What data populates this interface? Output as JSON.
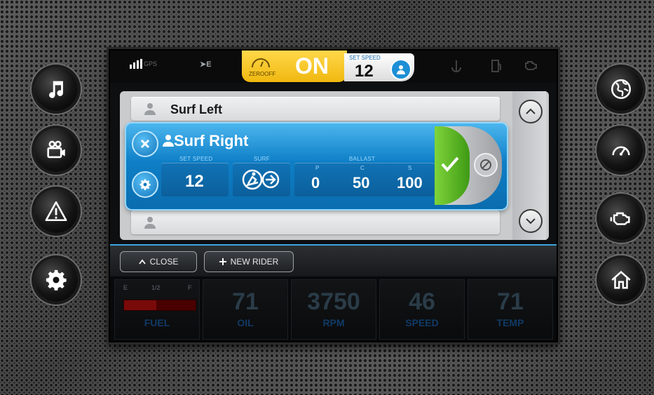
{
  "left_buttons": [
    {
      "icon": "music-note-icon"
    },
    {
      "icon": "video-camera-icon"
    },
    {
      "icon": "warning-icon"
    },
    {
      "icon": "gear-icon"
    }
  ],
  "right_buttons": [
    {
      "icon": "globe-icon"
    },
    {
      "icon": "speedometer-icon"
    },
    {
      "icon": "engine-icon"
    },
    {
      "icon": "home-icon"
    }
  ],
  "topbar": {
    "gps_label": "GPS",
    "heading": "➤E",
    "zero_off_label": "ZEROOFF",
    "zero_off_state": "ON",
    "set_speed_label": "SET SPEED",
    "set_speed_value": "12"
  },
  "riders": {
    "above": "Surf Left",
    "below": "",
    "selected": {
      "name": "Surf Right",
      "set_speed_label": "SET SPEED",
      "set_speed_value": "12",
      "surf_label": "SURF",
      "ballast_label": "BALLAST",
      "ballast": [
        {
          "label": "P",
          "value": "0"
        },
        {
          "label": "C",
          "value": "50"
        },
        {
          "label": "S",
          "value": "100"
        }
      ]
    }
  },
  "bottombar": {
    "close_label": "CLOSE",
    "new_rider_label": "NEW RIDER"
  },
  "gauges": {
    "fuel": {
      "label": "FUEL",
      "e": "E",
      "half": "1/2",
      "f": "F",
      "level": 0.45
    },
    "oil": {
      "value": "71",
      "label": "OIL"
    },
    "rpm": {
      "value": "3750",
      "label": "RPM"
    },
    "speed": {
      "value": "46",
      "label": "SPEED"
    },
    "temp": {
      "value": "71",
      "label": "TEMP"
    }
  },
  "colors": {
    "accent": "#1d8fd6",
    "zero_off": "#f6c622",
    "apply": "#58b824"
  }
}
